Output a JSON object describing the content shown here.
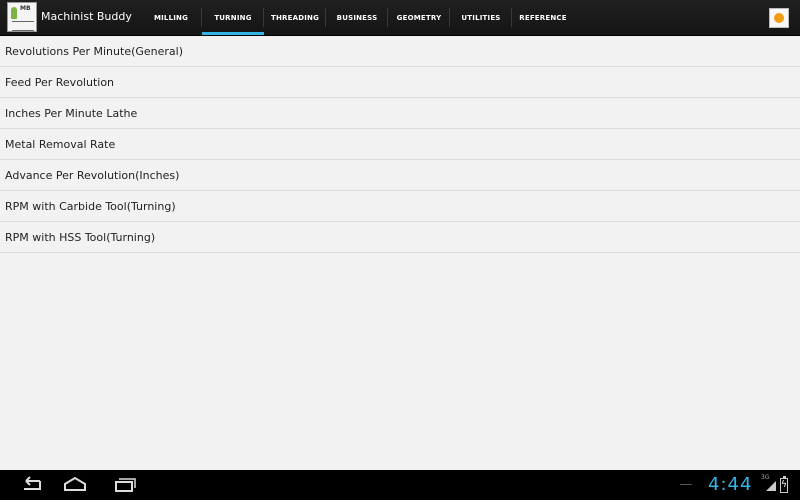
{
  "app": {
    "title": "Machinist Buddy",
    "icon_name": "machinist-buddy-logo-icon",
    "overflow_icon_name": "app-menu-icon"
  },
  "tabs": [
    {
      "label": "MILLING",
      "active": false
    },
    {
      "label": "TURNING",
      "active": true
    },
    {
      "label": "THREADING",
      "active": false
    },
    {
      "label": "BUSINESS",
      "active": false
    },
    {
      "label": "GEOMETRY",
      "active": false
    },
    {
      "label": "UTILITIES",
      "active": false
    },
    {
      "label": "REFERENCE",
      "active": false
    }
  ],
  "list": [
    "Revolutions Per Minute(General)",
    "Feed Per Revolution",
    "Inches Per Minute Lathe",
    "Metal Removal Rate",
    "Advance Per Revolution(Inches)",
    "RPM with Carbide Tool(Turning)",
    "RPM with HSS Tool(Turning)"
  ],
  "system": {
    "clock": "4:44",
    "network": "3G",
    "icons": [
      "back-icon",
      "home-icon",
      "recent-apps-icon",
      "signal-icon",
      "battery-charging-icon"
    ]
  },
  "colors": {
    "accent": "#33b5e5",
    "actionbar": "#1a1a1a",
    "background": "#f2f2f2"
  }
}
